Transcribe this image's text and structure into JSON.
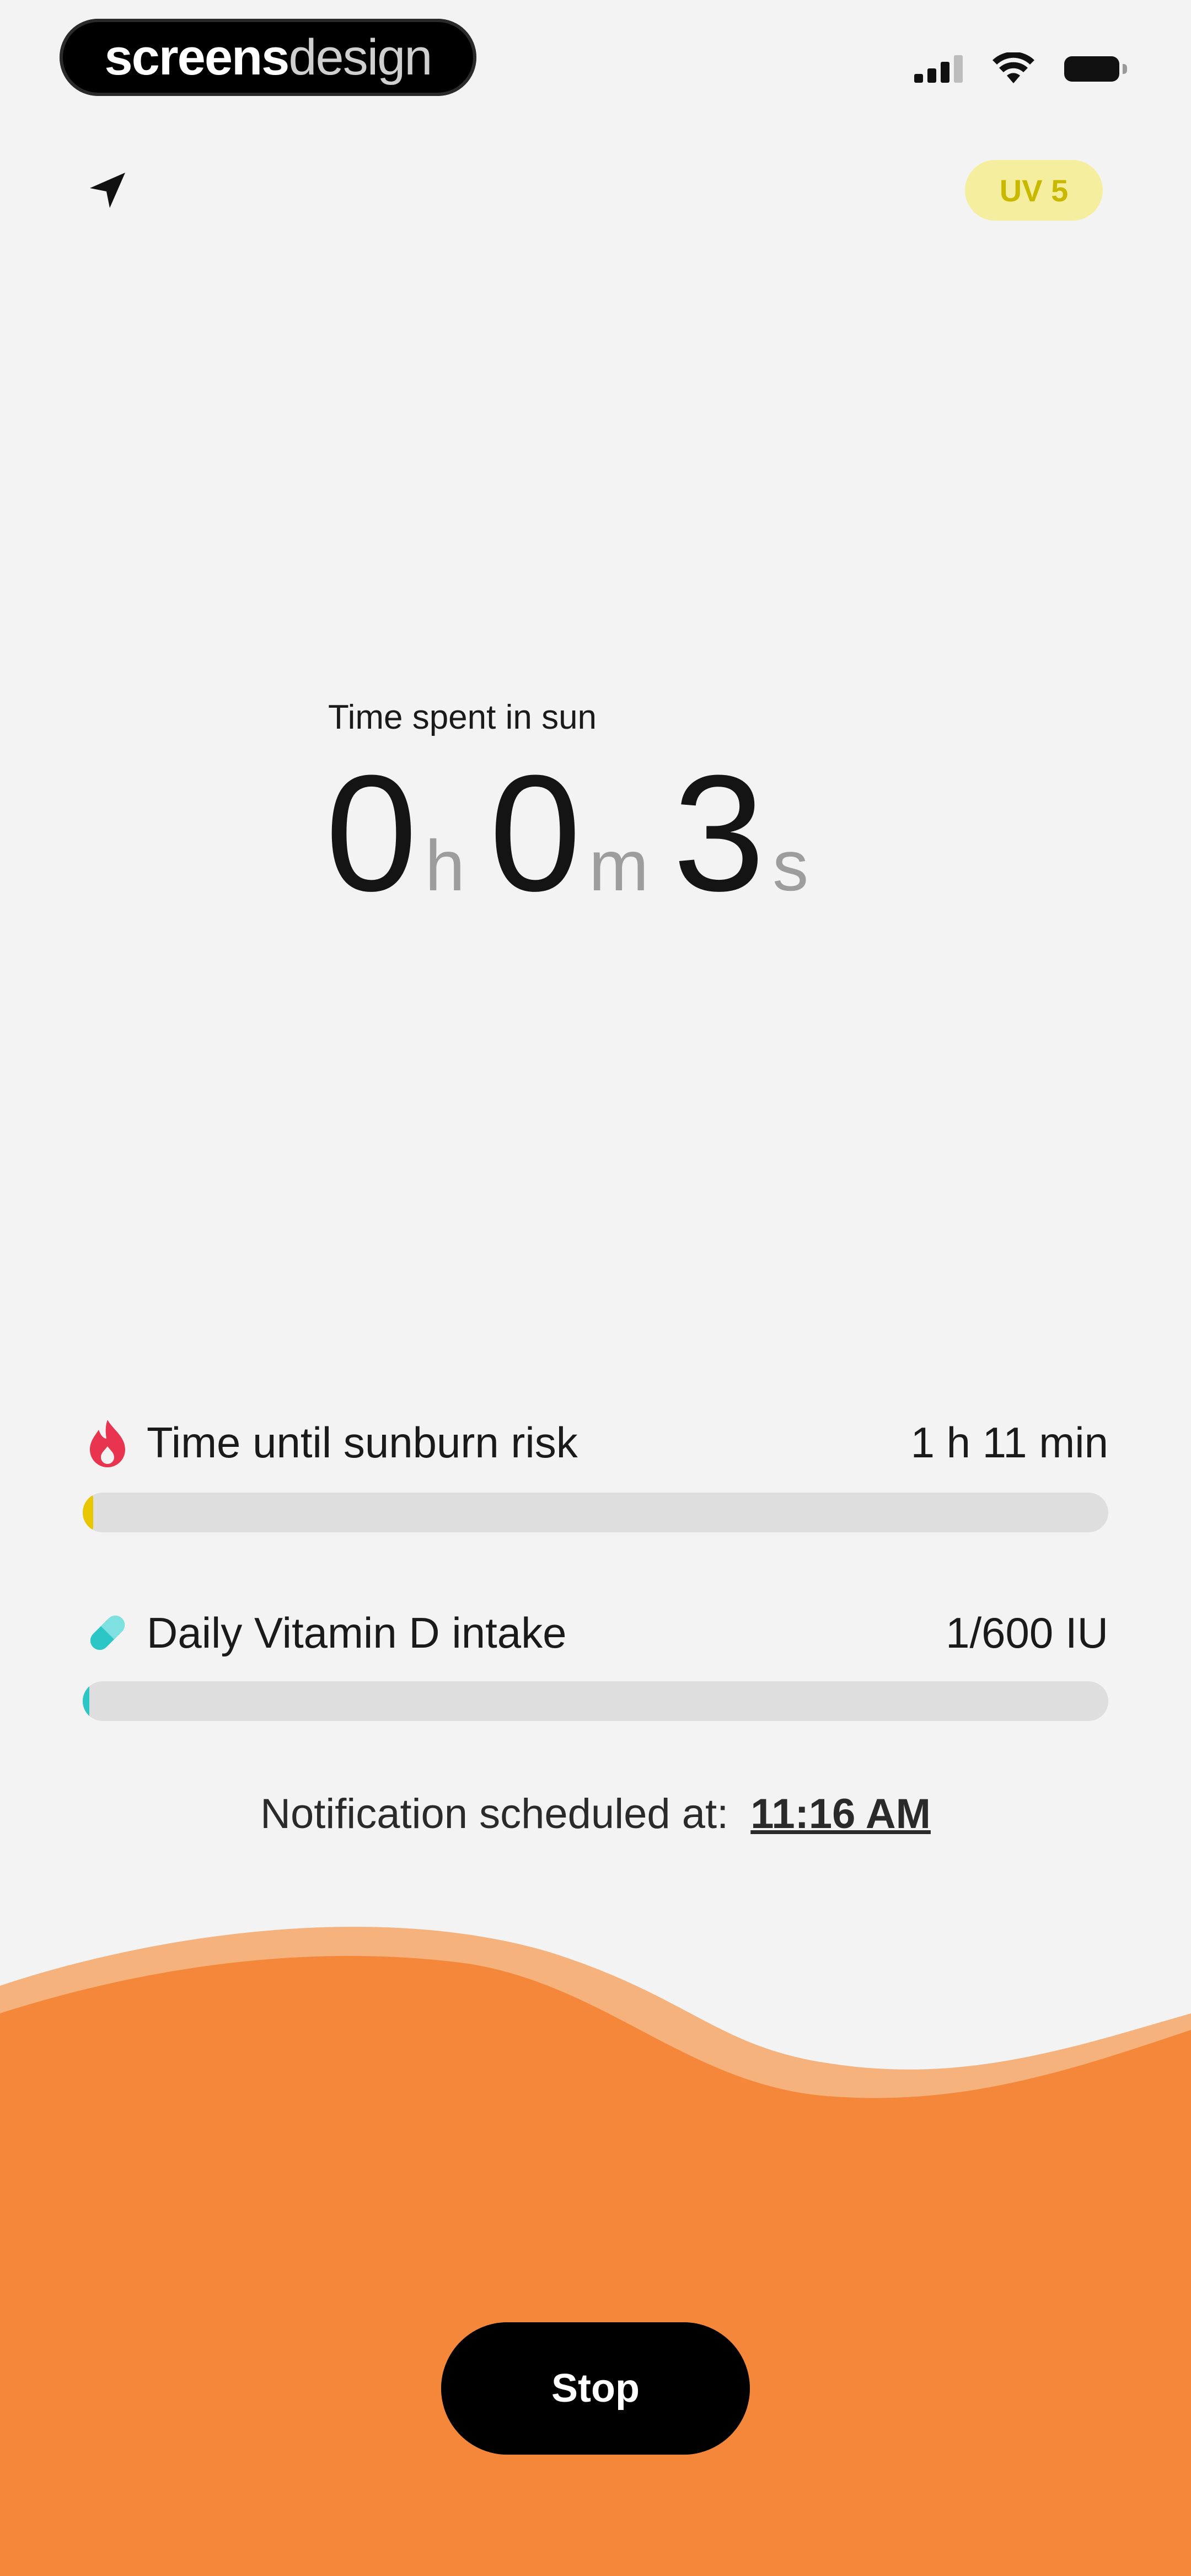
{
  "status_bar": {
    "brand_bold": "screens",
    "brand_light": "design"
  },
  "header": {
    "uv_badge": "UV 5"
  },
  "timer": {
    "label": "Time spent in sun",
    "hours": "0",
    "hours_unit": "h",
    "minutes": "0",
    "minutes_unit": "m",
    "seconds": "3",
    "seconds_unit": "s"
  },
  "stats": {
    "sunburn": {
      "label": "Time until sunburn risk",
      "value": "1 h 11 min",
      "progress": 0.01,
      "color": "#e8c600",
      "icon": "flame-icon"
    },
    "vitamin": {
      "label": "Daily Vitamin D intake",
      "value": "1/600 IU",
      "progress": 0.002,
      "color": "#2cc6c6",
      "icon": "pill-icon"
    }
  },
  "notification": {
    "label": "Notification scheduled at:",
    "time": "11:16 AM"
  },
  "actions": {
    "stop_label": "Stop"
  },
  "colors": {
    "accent_orange": "#f4873a",
    "wave_light": "#f6b27c",
    "uv_yellow": "#f5ee9e",
    "flame_red": "#e8344e",
    "pill_teal": "#2cc6c6"
  }
}
